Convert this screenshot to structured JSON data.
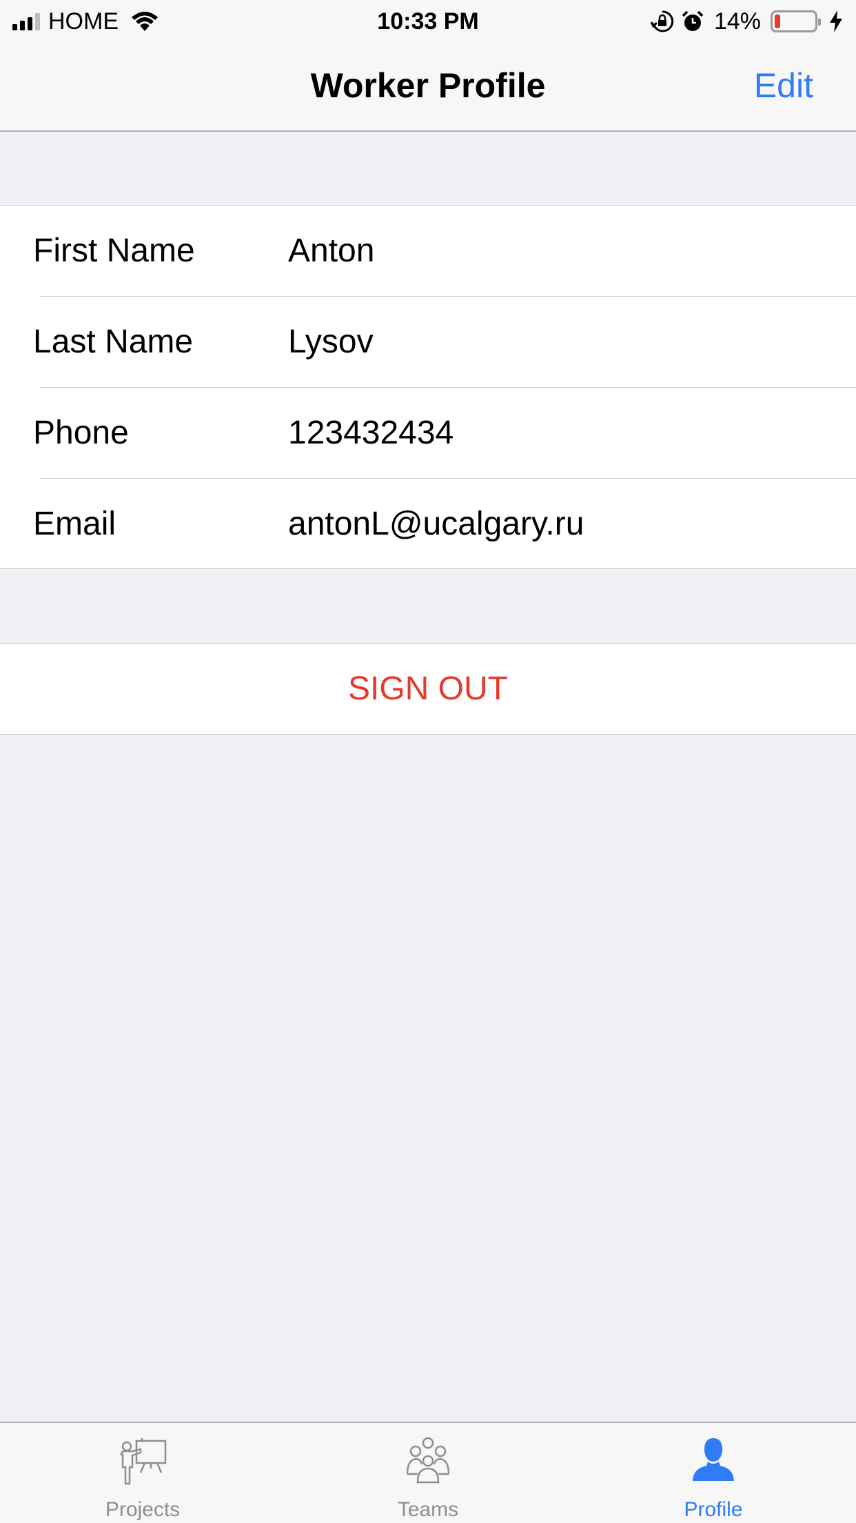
{
  "status_bar": {
    "carrier": "HOME",
    "time": "10:33 PM",
    "battery_percent": "14%",
    "battery_level": 0.14,
    "icons": [
      "signal-icon",
      "wifi-icon",
      "orientation-lock-icon",
      "alarm-icon",
      "battery-icon",
      "charging-bolt-icon"
    ]
  },
  "nav": {
    "title": "Worker Profile",
    "edit_label": "Edit"
  },
  "profile": {
    "rows": [
      {
        "label": "First Name",
        "value": "Anton"
      },
      {
        "label": "Last Name",
        "value": "Lysov"
      },
      {
        "label": "Phone",
        "value": "123432434"
      },
      {
        "label": "Email",
        "value": "antonL@ucalgary.ru"
      }
    ]
  },
  "actions": {
    "sign_out_label": "SIGN OUT"
  },
  "tab_bar": {
    "tabs": [
      {
        "label": "Projects",
        "icon": "presentation-icon",
        "active": false
      },
      {
        "label": "Teams",
        "icon": "group-icon",
        "active": false
      },
      {
        "label": "Profile",
        "icon": "person-icon",
        "active": true
      }
    ]
  },
  "colors": {
    "accent": "#2f7cf6",
    "destructive": "#e23b2c",
    "background": "#efeff4",
    "inactive": "#8e8e93"
  }
}
